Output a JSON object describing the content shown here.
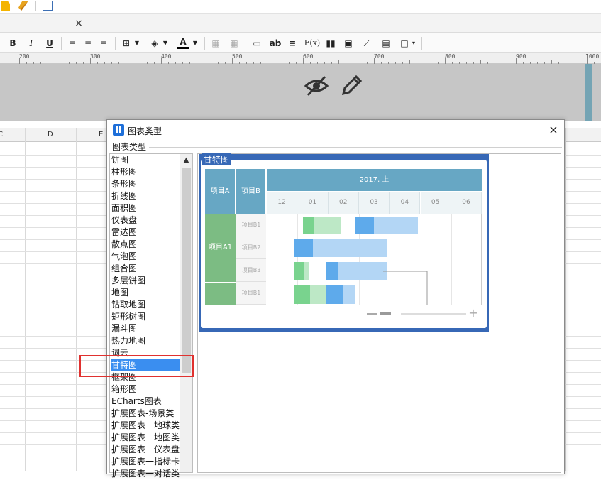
{
  "app": {
    "tab_close_label": "×"
  },
  "format_toolbar": {
    "bold": "B",
    "italic": "I",
    "underline": "U",
    "text_style": "ab",
    "formula": "F(x)"
  },
  "ruler": {
    "labels": [
      "200",
      "300",
      "400",
      "500",
      "600",
      "700",
      "800",
      "900",
      "1000"
    ]
  },
  "sheet": {
    "columns": [
      "C",
      "D",
      "E"
    ]
  },
  "dialog": {
    "title": "图表类型",
    "close_label": "×",
    "section_label": "图表类型",
    "chart_types": [
      "饼图",
      "柱形图",
      "条形图",
      "折线图",
      "面积图",
      "仪表盘",
      "雷达图",
      "散点图",
      "气泡图",
      "组合图",
      "多层饼图",
      "地图",
      "钻取地图",
      "矩形树图",
      "漏斗图",
      "热力地图",
      "词云",
      "甘特图",
      "框架图",
      "箱形图",
      "ECharts图表",
      "扩展图表-场景类",
      "扩展图表一地球类",
      "扩展图表一地图类",
      "扩展图表一仪表盘",
      "扩展图表一指标卡",
      "扩展图表一对话类"
    ],
    "selected_index": 17,
    "preview": {
      "title": "甘特图",
      "gantt": {
        "header_a": "项目A",
        "header_b": "项目B",
        "period": "2017, 上",
        "months": [
          "12",
          "01",
          "02",
          "03",
          "04",
          "05",
          "06"
        ],
        "group": "项目A1",
        "rows": [
          "项目B1",
          "项目B2",
          "项目B3",
          "项目B1"
        ]
      }
    }
  },
  "colors": {
    "selection": "#3a8ef0",
    "highlight_box": "#e0312f",
    "preview_frame": "#3768b6",
    "gantt_header": "#67a7c4",
    "gantt_group": "#7cbc83",
    "bar_green": "#79d38e",
    "bar_green_light": "#bde8c6",
    "bar_blue": "#5eaaeb",
    "bar_blue_light": "#b3d6f5"
  }
}
